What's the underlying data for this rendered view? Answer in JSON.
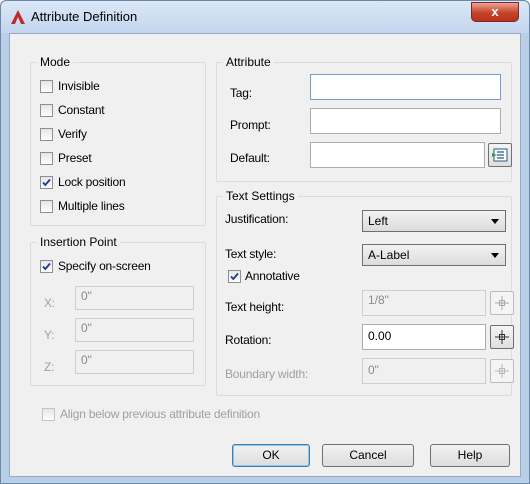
{
  "window": {
    "title": "Attribute Definition",
    "close_symbol": "x",
    "accent": "#c1272d"
  },
  "mode": {
    "label": "Mode",
    "options": [
      {
        "label": "Invisible",
        "checked": false
      },
      {
        "label": "Constant",
        "checked": false
      },
      {
        "label": "Verify",
        "checked": false
      },
      {
        "label": "Preset",
        "checked": false
      },
      {
        "label": "Lock position",
        "checked": true
      },
      {
        "label": "Multiple lines",
        "checked": false
      }
    ]
  },
  "insertion": {
    "label": "Insertion Point",
    "specify_label": "Specify on-screen",
    "specify_checked": true,
    "x_label": "X:",
    "x_value": "0\"",
    "y_label": "Y:",
    "y_value": "0\"",
    "z_label": "Z:",
    "z_value": "0\""
  },
  "attribute": {
    "label": "Attribute",
    "tag_label": "Tag:",
    "tag_value": "",
    "prompt_label": "Prompt:",
    "prompt_value": "",
    "default_label": "Default:",
    "default_value": ""
  },
  "text_settings": {
    "label": "Text Settings",
    "justification_label": "Justification:",
    "justification_value": "Left",
    "style_label": "Text style:",
    "style_value": "A-Label",
    "annotative_label": "Annotative",
    "annotative_checked": true,
    "height_label": "Text height:",
    "height_value": "1/8\"",
    "rotation_label": "Rotation:",
    "rotation_value": "0.00",
    "boundary_label": "Boundary width:",
    "boundary_value": "0\""
  },
  "align_label": "Align below previous attribute definition",
  "buttons": {
    "ok": "OK",
    "cancel": "Cancel",
    "help": "Help"
  }
}
